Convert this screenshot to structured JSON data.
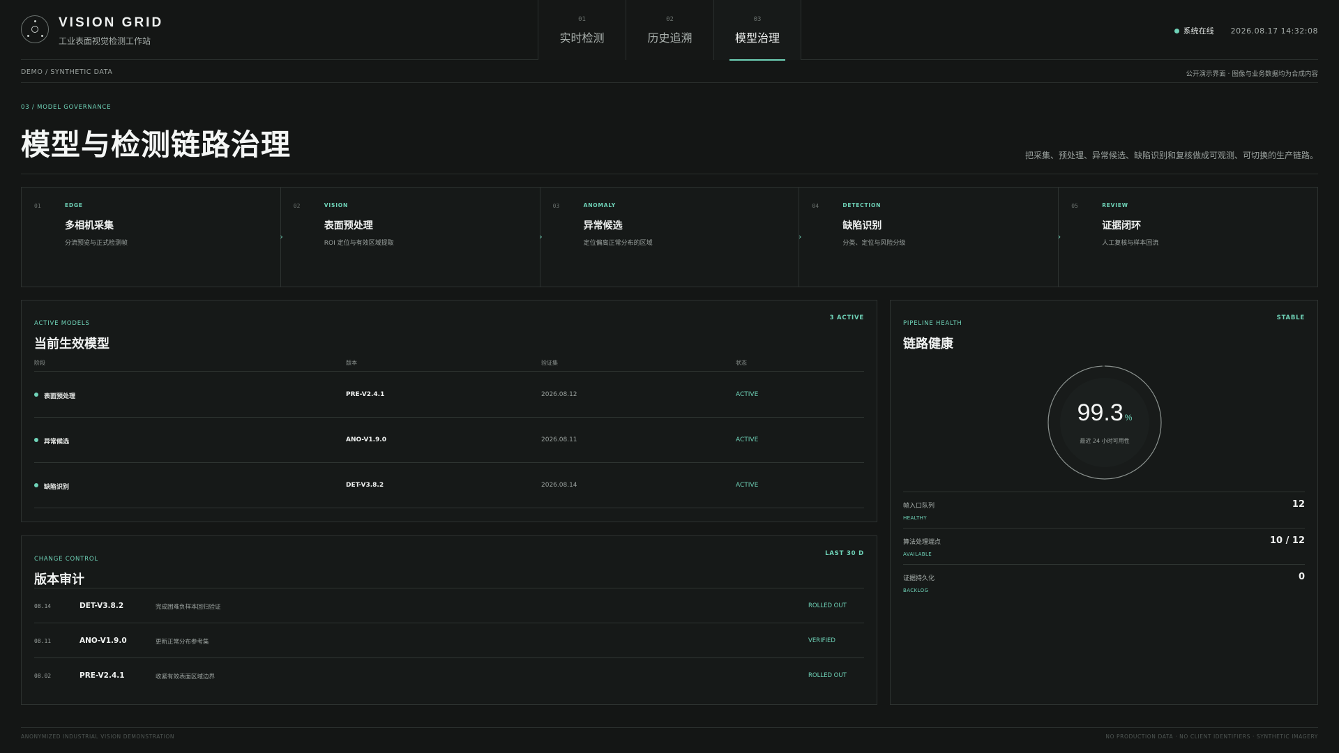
{
  "brand": {
    "title": "VISION GRID",
    "subtitle": "工业表面视觉检测工作站",
    "logo_icon": "lens-icon"
  },
  "nav": {
    "tabs": [
      {
        "num": "01",
        "label": "实时检测",
        "active": false
      },
      {
        "num": "02",
        "label": "历史追溯",
        "active": false
      },
      {
        "num": "03",
        "label": "模型治理",
        "active": true
      }
    ]
  },
  "status": {
    "label": "系统在线",
    "datetime": "2026.08.17   14:32:08",
    "color": "#6fd3b8"
  },
  "subbar": {
    "left": "DEMO / SYNTHETIC DATA",
    "right": "公开演示界面 · 图像与业务数据均为合成内容"
  },
  "page": {
    "eyebrow": "03 / MODEL GOVERNANCE",
    "title": "模型与检测链路治理",
    "description": "把采集、预处理、异常候选、缺陷识别和复核做成可观测、可切换的生产链路。"
  },
  "stages": [
    {
      "num": "01",
      "tag": "EDGE",
      "name": "多相机采集",
      "desc": "分流预览与正式检测帧"
    },
    {
      "num": "02",
      "tag": "VISION",
      "name": "表面预处理",
      "desc": "ROI 定位与有效区域提取"
    },
    {
      "num": "03",
      "tag": "ANOMALY",
      "name": "异常候选",
      "desc": "定位偏离正常分布的区域"
    },
    {
      "num": "04",
      "tag": "DETECTION",
      "name": "缺陷识别",
      "desc": "分类、定位与风险分级"
    },
    {
      "num": "05",
      "tag": "REVIEW",
      "name": "证据闭环",
      "desc": "人工复核与样本回流"
    }
  ],
  "active_models": {
    "tag": "ACTIVE MODELS",
    "count": "3 ACTIVE",
    "title": "当前生效模型",
    "columns": [
      "阶段",
      "版本",
      "验证集",
      "状态"
    ],
    "rows": [
      {
        "stage": "表面预处理",
        "version": "PRE-V2.4.1",
        "dataset": "2026.08.12",
        "status": "ACTIVE"
      },
      {
        "stage": "异常候选",
        "version": "ANO-V1.9.0",
        "dataset": "2026.08.11",
        "status": "ACTIVE"
      },
      {
        "stage": "缺陷识别",
        "version": "DET-V3.8.2",
        "dataset": "2026.08.14",
        "status": "ACTIVE"
      }
    ]
  },
  "change_control": {
    "tag": "CHANGE CONTROL",
    "range": "LAST 30 D",
    "title": "版本审计",
    "rows": [
      {
        "date": "08.14",
        "version": "DET-V3.8.2",
        "note": "完成困难负样本回归验证",
        "status": "ROLLED OUT"
      },
      {
        "date": "08.11",
        "version": "ANO-V1.9.0",
        "note": "更新正常分布参考集",
        "status": "VERIFIED"
      },
      {
        "date": "08.02",
        "version": "PRE-V2.4.1",
        "note": "收紧有效表面区域边界",
        "status": "ROLLED OUT"
      }
    ]
  },
  "health": {
    "tag": "PIPELINE HEALTH",
    "state": "STABLE",
    "title": "链路健康",
    "value": "99.3",
    "unit": "%",
    "value_fraction": 0.993,
    "caption": "最近 24 小时可用性",
    "metrics": [
      {
        "label": "帧入口队列",
        "sub": "HEALTHY",
        "value": "12"
      },
      {
        "label": "算法处理端点",
        "sub": "AVAILABLE",
        "value": "10 / 12"
      },
      {
        "label": "证据持久化",
        "sub": "BACKLOG",
        "value": "0"
      }
    ]
  },
  "footer": {
    "left": "ANONYMIZED INDUSTRIAL VISION DEMONSTRATION",
    "right": "NO PRODUCTION DATA · NO CLIENT IDENTIFIERS · SYNTHETIC IMAGERY"
  }
}
